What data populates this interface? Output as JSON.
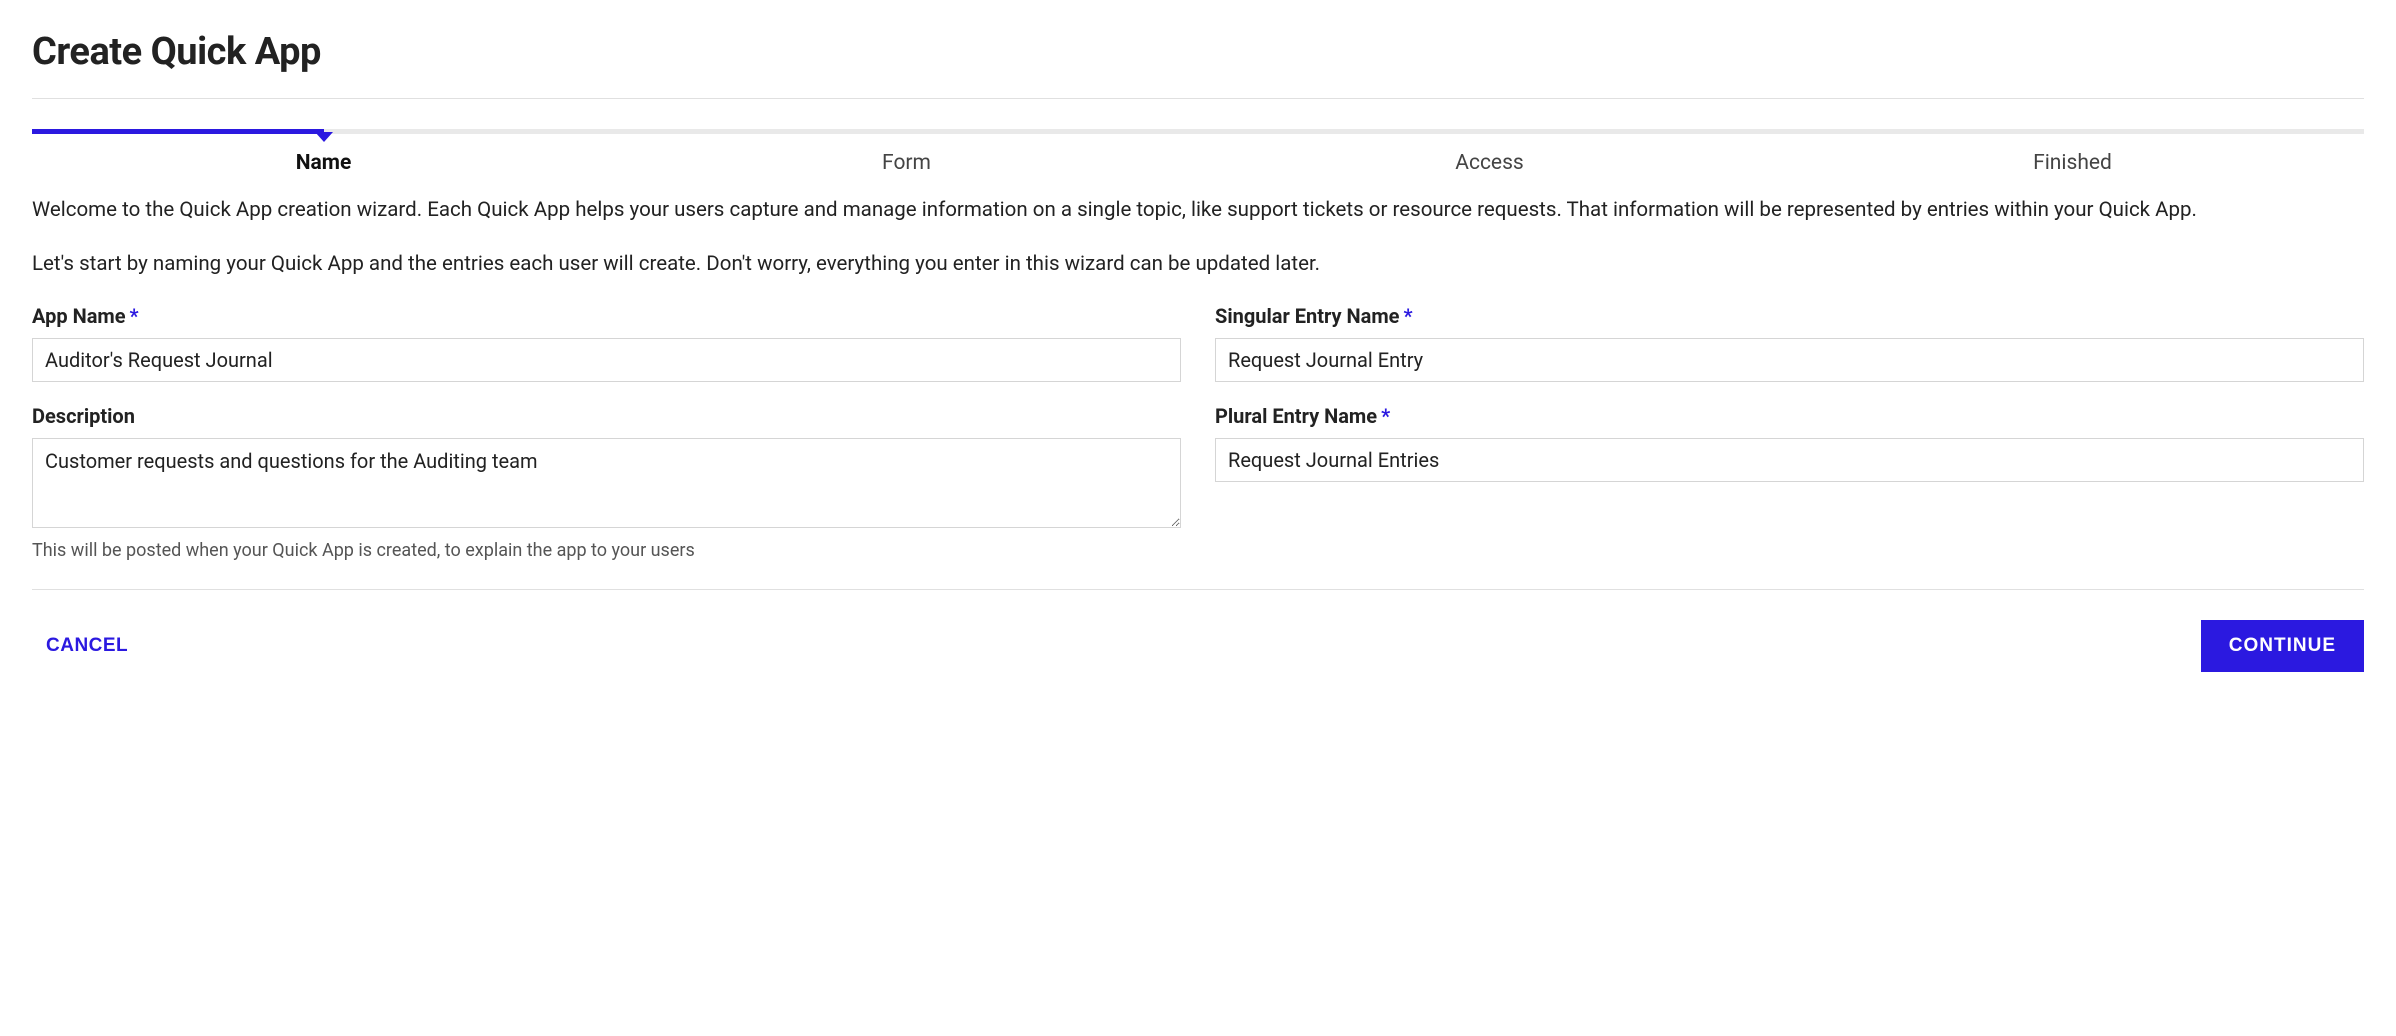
{
  "page": {
    "title": "Create Quick App"
  },
  "wizard": {
    "steps": [
      {
        "label": "Name",
        "active": true
      },
      {
        "label": "Form",
        "active": false
      },
      {
        "label": "Access",
        "active": false
      },
      {
        "label": "Finished",
        "active": false
      }
    ],
    "step_count_total": 4,
    "completed_fraction_percent": 12.5
  },
  "intro": {
    "p1": "Welcome to the Quick App creation wizard. Each Quick App helps your users capture and manage information on a single topic, like support tickets or resource requests. That information will be represented by entries within your Quick App.",
    "p2": "Let's start by naming your Quick App and the entries each user will create. Don't worry, everything you enter in this wizard can be updated later."
  },
  "form": {
    "required_mark": "*",
    "app_name": {
      "label": "App Name",
      "required": true,
      "value": "Auditor's Request Journal"
    },
    "singular_entry_name": {
      "label": "Singular Entry Name",
      "required": true,
      "value": "Request Journal Entry"
    },
    "description": {
      "label": "Description",
      "required": false,
      "value": "Customer requests and questions for the Auditing team",
      "helper": "This will be posted when your Quick App is created, to explain the app to your users"
    },
    "plural_entry_name": {
      "label": "Plural Entry Name",
      "required": true,
      "value": "Request Journal Entries"
    }
  },
  "actions": {
    "cancel": "CANCEL",
    "continue": "CONTINUE"
  },
  "colors": {
    "accent": "#2b19e0"
  }
}
